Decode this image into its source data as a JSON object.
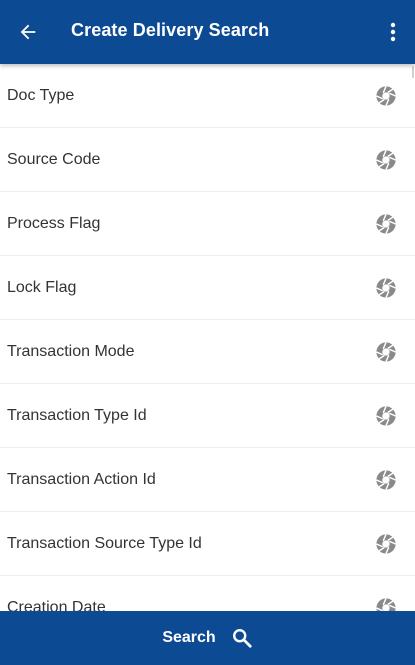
{
  "app": {
    "title": "Create Delivery Search",
    "colors": {
      "header_bg": "#0d4a94",
      "footer_bg": "#0d4a94",
      "icon_gray": "#8a8a8a",
      "text": "#333333"
    }
  },
  "header": {
    "back_icon": "arrow-left-icon",
    "menu_icon": "more-vertical-icon"
  },
  "list": {
    "items": [
      {
        "label": "Doc Type",
        "icon": "aperture-icon"
      },
      {
        "label": "Source Code",
        "icon": "aperture-icon"
      },
      {
        "label": "Process Flag",
        "icon": "aperture-icon"
      },
      {
        "label": "Lock Flag",
        "icon": "aperture-icon"
      },
      {
        "label": "Transaction Mode",
        "icon": "aperture-icon"
      },
      {
        "label": "Transaction Type Id",
        "icon": "aperture-icon"
      },
      {
        "label": "Transaction Action Id",
        "icon": "aperture-icon"
      },
      {
        "label": "Transaction Source Type Id",
        "icon": "aperture-icon"
      },
      {
        "label": "Creation Date",
        "icon": "aperture-icon"
      }
    ]
  },
  "footer": {
    "search_label": "Search",
    "search_icon": "search-icon"
  }
}
